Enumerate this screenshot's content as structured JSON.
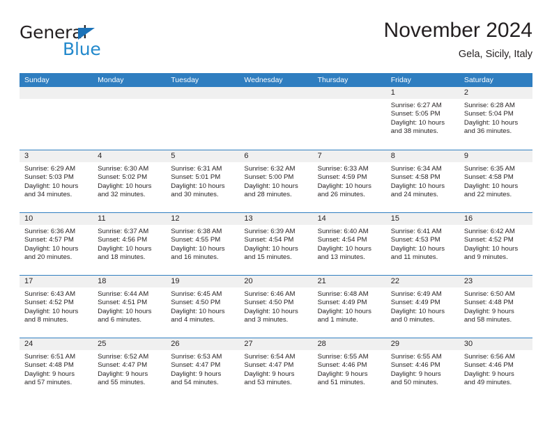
{
  "brand": {
    "name_top": "General",
    "name_bottom": "Blue",
    "triangle_color": "#1b72b8",
    "blue_color": "#2389cc"
  },
  "header": {
    "title": "November 2024",
    "subtitle": "Gela, Sicily, Italy"
  },
  "colors": {
    "header_band": "#2f7ec0",
    "day_number_band": "#f0f0f0",
    "text": "#231f20"
  },
  "weekdays": [
    "Sunday",
    "Monday",
    "Tuesday",
    "Wednesday",
    "Thursday",
    "Friday",
    "Saturday"
  ],
  "weeks": [
    [
      {
        "day": "",
        "lines": []
      },
      {
        "day": "",
        "lines": []
      },
      {
        "day": "",
        "lines": []
      },
      {
        "day": "",
        "lines": []
      },
      {
        "day": "",
        "lines": []
      },
      {
        "day": "1",
        "lines": [
          "Sunrise: 6:27 AM",
          "Sunset: 5:05 PM",
          "Daylight: 10 hours",
          "and 38 minutes."
        ]
      },
      {
        "day": "2",
        "lines": [
          "Sunrise: 6:28 AM",
          "Sunset: 5:04 PM",
          "Daylight: 10 hours",
          "and 36 minutes."
        ]
      }
    ],
    [
      {
        "day": "3",
        "lines": [
          "Sunrise: 6:29 AM",
          "Sunset: 5:03 PM",
          "Daylight: 10 hours",
          "and 34 minutes."
        ]
      },
      {
        "day": "4",
        "lines": [
          "Sunrise: 6:30 AM",
          "Sunset: 5:02 PM",
          "Daylight: 10 hours",
          "and 32 minutes."
        ]
      },
      {
        "day": "5",
        "lines": [
          "Sunrise: 6:31 AM",
          "Sunset: 5:01 PM",
          "Daylight: 10 hours",
          "and 30 minutes."
        ]
      },
      {
        "day": "6",
        "lines": [
          "Sunrise: 6:32 AM",
          "Sunset: 5:00 PM",
          "Daylight: 10 hours",
          "and 28 minutes."
        ]
      },
      {
        "day": "7",
        "lines": [
          "Sunrise: 6:33 AM",
          "Sunset: 4:59 PM",
          "Daylight: 10 hours",
          "and 26 minutes."
        ]
      },
      {
        "day": "8",
        "lines": [
          "Sunrise: 6:34 AM",
          "Sunset: 4:58 PM",
          "Daylight: 10 hours",
          "and 24 minutes."
        ]
      },
      {
        "day": "9",
        "lines": [
          "Sunrise: 6:35 AM",
          "Sunset: 4:58 PM",
          "Daylight: 10 hours",
          "and 22 minutes."
        ]
      }
    ],
    [
      {
        "day": "10",
        "lines": [
          "Sunrise: 6:36 AM",
          "Sunset: 4:57 PM",
          "Daylight: 10 hours",
          "and 20 minutes."
        ]
      },
      {
        "day": "11",
        "lines": [
          "Sunrise: 6:37 AM",
          "Sunset: 4:56 PM",
          "Daylight: 10 hours",
          "and 18 minutes."
        ]
      },
      {
        "day": "12",
        "lines": [
          "Sunrise: 6:38 AM",
          "Sunset: 4:55 PM",
          "Daylight: 10 hours",
          "and 16 minutes."
        ]
      },
      {
        "day": "13",
        "lines": [
          "Sunrise: 6:39 AM",
          "Sunset: 4:54 PM",
          "Daylight: 10 hours",
          "and 15 minutes."
        ]
      },
      {
        "day": "14",
        "lines": [
          "Sunrise: 6:40 AM",
          "Sunset: 4:54 PM",
          "Daylight: 10 hours",
          "and 13 minutes."
        ]
      },
      {
        "day": "15",
        "lines": [
          "Sunrise: 6:41 AM",
          "Sunset: 4:53 PM",
          "Daylight: 10 hours",
          "and 11 minutes."
        ]
      },
      {
        "day": "16",
        "lines": [
          "Sunrise: 6:42 AM",
          "Sunset: 4:52 PM",
          "Daylight: 10 hours",
          "and 9 minutes."
        ]
      }
    ],
    [
      {
        "day": "17",
        "lines": [
          "Sunrise: 6:43 AM",
          "Sunset: 4:52 PM",
          "Daylight: 10 hours",
          "and 8 minutes."
        ]
      },
      {
        "day": "18",
        "lines": [
          "Sunrise: 6:44 AM",
          "Sunset: 4:51 PM",
          "Daylight: 10 hours",
          "and 6 minutes."
        ]
      },
      {
        "day": "19",
        "lines": [
          "Sunrise: 6:45 AM",
          "Sunset: 4:50 PM",
          "Daylight: 10 hours",
          "and 4 minutes."
        ]
      },
      {
        "day": "20",
        "lines": [
          "Sunrise: 6:46 AM",
          "Sunset: 4:50 PM",
          "Daylight: 10 hours",
          "and 3 minutes."
        ]
      },
      {
        "day": "21",
        "lines": [
          "Sunrise: 6:48 AM",
          "Sunset: 4:49 PM",
          "Daylight: 10 hours",
          "and 1 minute."
        ]
      },
      {
        "day": "22",
        "lines": [
          "Sunrise: 6:49 AM",
          "Sunset: 4:49 PM",
          "Daylight: 10 hours",
          "and 0 minutes."
        ]
      },
      {
        "day": "23",
        "lines": [
          "Sunrise: 6:50 AM",
          "Sunset: 4:48 PM",
          "Daylight: 9 hours",
          "and 58 minutes."
        ]
      }
    ],
    [
      {
        "day": "24",
        "lines": [
          "Sunrise: 6:51 AM",
          "Sunset: 4:48 PM",
          "Daylight: 9 hours",
          "and 57 minutes."
        ]
      },
      {
        "day": "25",
        "lines": [
          "Sunrise: 6:52 AM",
          "Sunset: 4:47 PM",
          "Daylight: 9 hours",
          "and 55 minutes."
        ]
      },
      {
        "day": "26",
        "lines": [
          "Sunrise: 6:53 AM",
          "Sunset: 4:47 PM",
          "Daylight: 9 hours",
          "and 54 minutes."
        ]
      },
      {
        "day": "27",
        "lines": [
          "Sunrise: 6:54 AM",
          "Sunset: 4:47 PM",
          "Daylight: 9 hours",
          "and 53 minutes."
        ]
      },
      {
        "day": "28",
        "lines": [
          "Sunrise: 6:55 AM",
          "Sunset: 4:46 PM",
          "Daylight: 9 hours",
          "and 51 minutes."
        ]
      },
      {
        "day": "29",
        "lines": [
          "Sunrise: 6:55 AM",
          "Sunset: 4:46 PM",
          "Daylight: 9 hours",
          "and 50 minutes."
        ]
      },
      {
        "day": "30",
        "lines": [
          "Sunrise: 6:56 AM",
          "Sunset: 4:46 PM",
          "Daylight: 9 hours",
          "and 49 minutes."
        ]
      }
    ]
  ]
}
